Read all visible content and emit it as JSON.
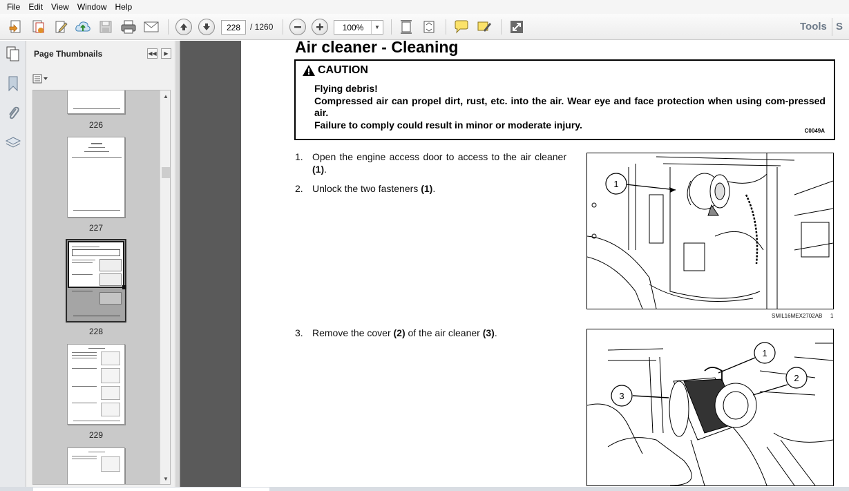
{
  "menu": [
    "File",
    "Edit",
    "View",
    "Window",
    "Help"
  ],
  "toolbar": {
    "page_current": "228",
    "page_total": "/ 1260",
    "zoom": "100%",
    "tools_label": "Tools",
    "tools_next": "S"
  },
  "thumbnails_panel": {
    "title": "Page Thumbnails",
    "pages": [
      "226",
      "227",
      "228",
      "229"
    ]
  },
  "document": {
    "title": "Air cleaner - Cleaning",
    "caution": {
      "heading": "CAUTION",
      "line1": "Flying debris!",
      "line2": "Compressed air can propel dirt, rust, etc. into the air. Wear eye and face protection when using com-pressed air.",
      "line3": "Failure to comply could result in minor or moderate injury.",
      "code": "C0049A"
    },
    "steps": [
      {
        "num": "1.",
        "pre": "Open the engine access door to access to the air cleaner ",
        "ref": "(1)",
        "post": "."
      },
      {
        "num": "2.",
        "pre": "Unlock the two fasteners ",
        "ref": "(1)",
        "post": "."
      },
      {
        "num": "3.",
        "pre": "Remove the cover ",
        "ref1": "(2)",
        "mid": " of the air cleaner ",
        "ref2": "(3)",
        "post": "."
      }
    ],
    "figure1": {
      "caption": "SMIL16MEX2702AB",
      "number": "1",
      "callouts": [
        "1"
      ]
    },
    "figure2": {
      "callouts": [
        "1",
        "2",
        "3"
      ]
    }
  }
}
